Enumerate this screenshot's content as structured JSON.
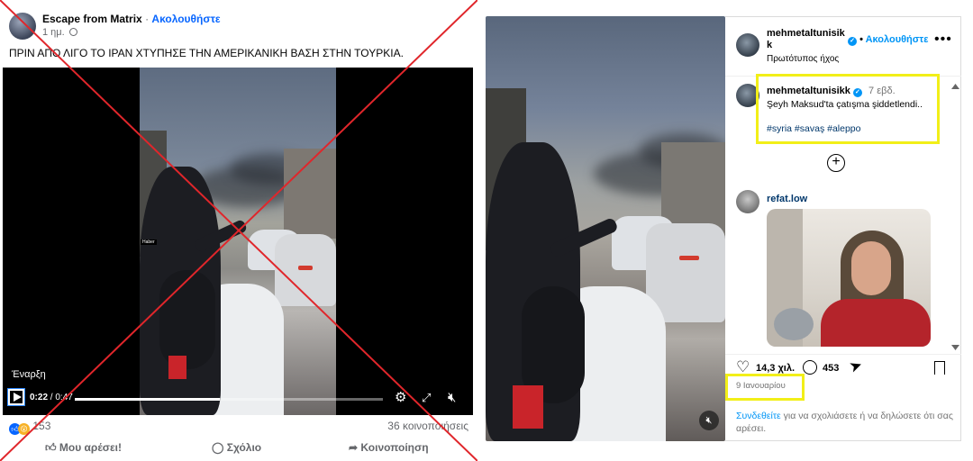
{
  "facebook": {
    "page_name": "Escape from Matrix",
    "follow_label": "Ακολουθήστε",
    "separator": "·",
    "time": "1 ημ.",
    "caption": "ΠΡΙΝ ΑΠΟ ΛΙΓΟ ΤΟ ΙΡΑΝ ΧΤΥΠΗΣΕ ΤΗΝ ΑΜΕΡΙΚΑΝΙΚΗ ΒΑΣΗ ΣΤΗΝ ΤΟΥΡΚΙΑ.",
    "video": {
      "start_label": "Έναρξη",
      "current_time": "0:22",
      "duration": "0:47",
      "progress": 0.47,
      "watermark": "Haber"
    },
    "reactions_count": "153",
    "shares": "36 κοινοποιήσεις",
    "actions": {
      "like": "Μου αρέσει!",
      "comment": "Σχόλιο",
      "share": "Κοινοποίηση"
    },
    "colors": {
      "accent": "#0866ff",
      "cross": "#e0262b"
    }
  },
  "instagram": {
    "author": "mehmetaltunisikk",
    "author_display_line1": "mehmetaltunisik",
    "author_display_line2": "k",
    "separator": "•",
    "follow_label": "Ακολουθήστε",
    "audio": "Πρωτότυπος ήχος",
    "caption_author": "mehmetaltunisikk",
    "caption_age": "7 εβδ.",
    "caption_text": "Şeyh Maksud'ta çatışma şiddetlendi..",
    "caption_tags": "#syria #savaş #aleppo",
    "comment_user": "refat.low",
    "likes": "14,3 χιλ.",
    "comments": "453",
    "date": "9 Ιανουαρίου",
    "login_link": "Συνδεθείτε",
    "login_text": " για να σχολιάσετε ή να δηλώσετε ότι σας αρέσει.",
    "colors": {
      "accent": "#0095f6",
      "highlight": "#f2ef18"
    }
  }
}
